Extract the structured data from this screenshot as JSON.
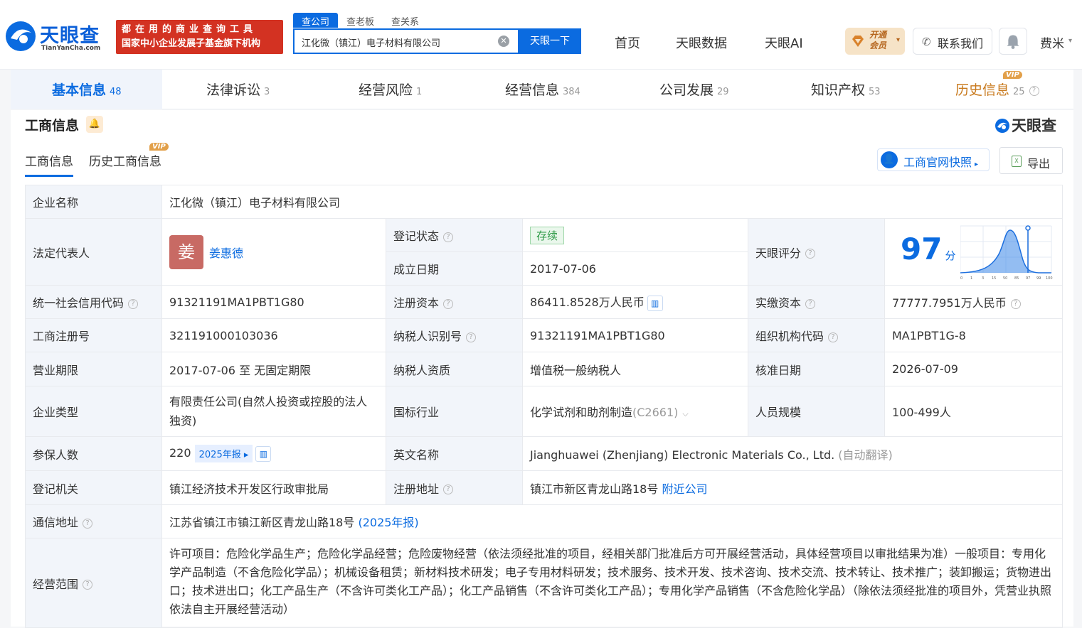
{
  "header": {
    "logo_name": "天眼查",
    "logo_domain": "TianYanCha.com",
    "banner_line1": "都在用的商业查询工具",
    "banner_line2": "国家中小企业发展子基金旗下机构",
    "search_tabs": [
      "查公司",
      "查老板",
      "查关系"
    ],
    "search_value": "江化微（镇江）电子材料有限公司",
    "search_button": "天眼一下",
    "nav": [
      "首页",
      "天眼数据",
      "天眼AI"
    ],
    "vip_line1": "开通",
    "vip_line2": "会员",
    "contact": "联系我们",
    "user": "费米"
  },
  "tabs": [
    {
      "label": "基本信息",
      "count": "48"
    },
    {
      "label": "法律诉讼",
      "count": "3"
    },
    {
      "label": "经营风险",
      "count": "1"
    },
    {
      "label": "经营信息",
      "count": "384"
    },
    {
      "label": "公司发展",
      "count": "29"
    },
    {
      "label": "知识产权",
      "count": "53"
    },
    {
      "label": "历史信息",
      "count": "25"
    }
  ],
  "vip_tag": "VIP",
  "card": {
    "title": "工商信息",
    "brand": "天眼查",
    "subtabs": [
      "工商信息",
      "历史工商信息"
    ],
    "snapshot_button": "工商官网快照",
    "export_button": "导出"
  },
  "info": {
    "company_name_label": "企业名称",
    "company_name": "江化微（镇江）电子材料有限公司",
    "legal_rep_label": "法定代表人",
    "legal_rep_avatar": "姜",
    "legal_rep": "姜惠德",
    "reg_status_label": "登记状态",
    "reg_status": "存续",
    "founded_label": "成立日期",
    "founded": "2017-07-06",
    "score_label": "天眼评分",
    "score": "97",
    "score_unit": "分",
    "score_axis": [
      "0",
      "1",
      "3",
      "15",
      "50",
      "85",
      "97",
      "99",
      "100"
    ],
    "uscc_label": "统一社会信用代码",
    "uscc": "91321191MA1PBT1G80",
    "reg_capital_label": "注册资本",
    "reg_capital": "86411.8528万人民币",
    "paid_capital_label": "实缴资本",
    "paid_capital": "77777.7951万人民币",
    "reg_no_label": "工商注册号",
    "reg_no": "321191000103036",
    "taxpayer_id_label": "纳税人识别号",
    "taxpayer_id": "91321191MA1PBT1G80",
    "org_code_label": "组织机构代码",
    "org_code": "MA1PBT1G-8",
    "term_label": "营业期限",
    "term": "2017-07-06 至 无固定期限",
    "taxpayer_qual_label": "纳税人资质",
    "taxpayer_qual": "增值税一般纳税人",
    "approved_label": "核准日期",
    "approved": "2026-07-09",
    "type_label": "企业类型",
    "type": "有限责任公司(自然人投资或控股的法人独资)",
    "industry_label": "国标行业",
    "industry": "化学试剂和助剂制造",
    "industry_code": "(C2661)",
    "staff_label": "人员规模",
    "staff": "100-499人",
    "insured_label": "参保人数",
    "insured": "220",
    "insured_report": "2025年报",
    "english_label": "英文名称",
    "english": "Jianghuawei (Zhenjiang) Electronic Materials Co., Ltd.",
    "english_note": "(自动翻译)",
    "authority_label": "登记机关",
    "authority": "镇江经济技术开发区行政审批局",
    "reg_addr_label": "注册地址",
    "reg_addr": "镇江市新区青龙山路18号",
    "nearby": "附近公司",
    "mail_addr_label": "通信地址",
    "mail_addr": "江苏省镇江市镇江新区青龙山路18号",
    "mail_addr_note": "(2025年报)",
    "scope_label": "经营范围",
    "scope": "许可项目：危险化学品生产；危险化学品经营；危险废物经营（依法须经批准的项目，经相关部门批准后方可开展经营活动，具体经营项目以审批结果为准）一般项目：专用化学产品制造（不含危险化学品）；机械设备租赁；新材料技术研发；电子专用材料研发；技术服务、技术开发、技术咨询、技术交流、技术转让、技术推广；装卸搬运；货物进出口；技术进出口；化工产品生产（不含许可类化工产品）；化工产品销售（不含许可类化工产品）；专用化学产品销售（不含危险化学品）（除依法须经批准的项目外，凭营业执照依法自主开展经营活动）"
  },
  "colors": {
    "primary": "#0b6be0",
    "banner": "#d33222",
    "status": "#2e9a47"
  }
}
